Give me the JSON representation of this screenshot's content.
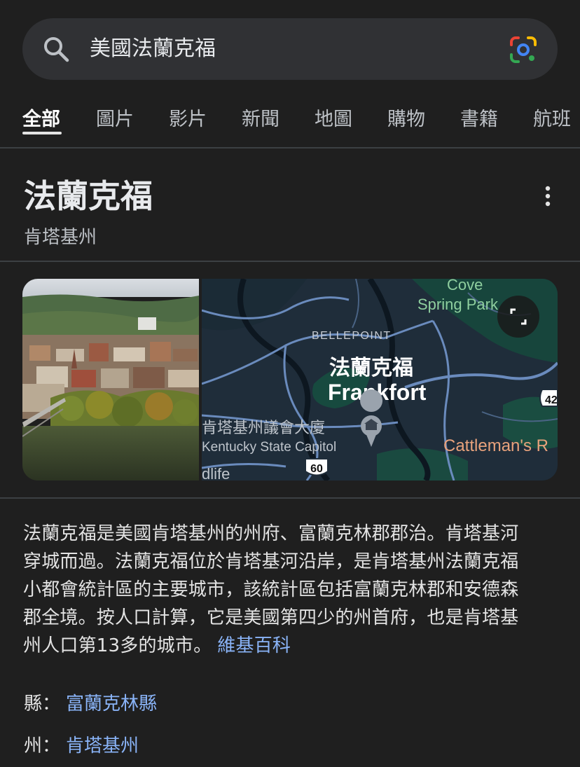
{
  "search": {
    "query": "美國法蘭克福"
  },
  "tabs": [
    {
      "label": "全部",
      "active": true
    },
    {
      "label": "圖片"
    },
    {
      "label": "影片"
    },
    {
      "label": "新聞"
    },
    {
      "label": "地圖"
    },
    {
      "label": "購物"
    },
    {
      "label": "書籍"
    },
    {
      "label": "航班"
    }
  ],
  "panel": {
    "title": "法蘭克福",
    "subtitle": "肯塔基州",
    "map_labels": {
      "park": "Cove",
      "park2": "Spring Park",
      "district": "BELLEPOINT",
      "city_zh": "法蘭克福",
      "city_en": "Frankfort",
      "capitol_zh": "肯塔基州議會大廈",
      "capitol_en": "Kentucky State Capitol",
      "shield_60": "60",
      "shield_421": "42",
      "restaurant": "Cattleman's R",
      "partial": "dlife"
    },
    "description_lines": [
      "法蘭克福是美國肯塔基州的州府、富蘭克林郡郡治。肯塔基河",
      "穿城而過。法蘭克福位於肯塔基河沿岸，是肯塔基州法蘭克福",
      "小都會統計區的主要城市，該統計區包括富蘭克林郡和安德森",
      "郡全境。按人口計算，它是美國第四少的州首府，也是肯塔基",
      "州人口第13多的城市。"
    ],
    "wiki_link": "維基百科",
    "facts": [
      {
        "key": "縣：",
        "value": "富蘭克林縣"
      },
      {
        "key": "州：",
        "value": "肯塔基州"
      }
    ]
  },
  "colors": {
    "background": "#1f1f1f",
    "link": "#8ab4f8",
    "searchbar": "#303134"
  }
}
